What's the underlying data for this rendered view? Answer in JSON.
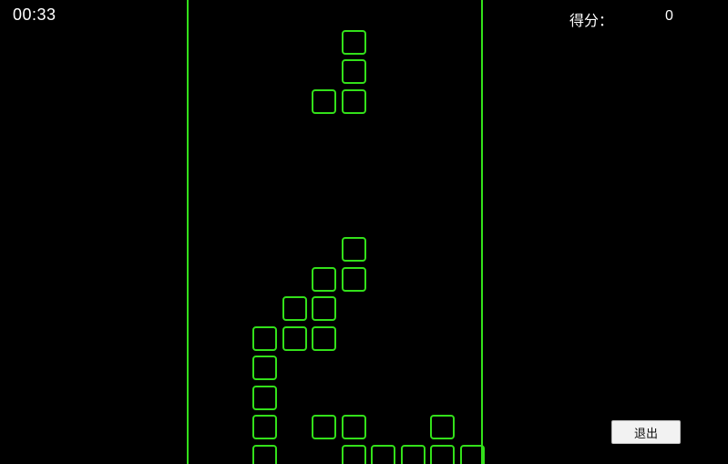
{
  "hud": {
    "timer": "00:33",
    "score_label": "得分：",
    "score_value": "0"
  },
  "controls": {
    "exit_label": "退出"
  },
  "board": {
    "columns": 10,
    "block_color": "#33e01a",
    "falling_piece": {
      "shape": "J",
      "cells": [
        [
          5,
          1
        ],
        [
          5,
          2
        ],
        [
          4,
          3
        ],
        [
          5,
          3
        ]
      ]
    },
    "settled_cells": [
      [
        5,
        8
      ],
      [
        4,
        9
      ],
      [
        5,
        9
      ],
      [
        3,
        10
      ],
      [
        4,
        10
      ],
      [
        2,
        11
      ],
      [
        3,
        11
      ],
      [
        4,
        11
      ],
      [
        2,
        12
      ],
      [
        2,
        13
      ],
      [
        2,
        14
      ],
      [
        4,
        14
      ],
      [
        5,
        14
      ],
      [
        8,
        14
      ],
      [
        2,
        15
      ],
      [
        5,
        15
      ],
      [
        6,
        15
      ],
      [
        7,
        15
      ],
      [
        8,
        15
      ],
      [
        9,
        15
      ]
    ]
  }
}
